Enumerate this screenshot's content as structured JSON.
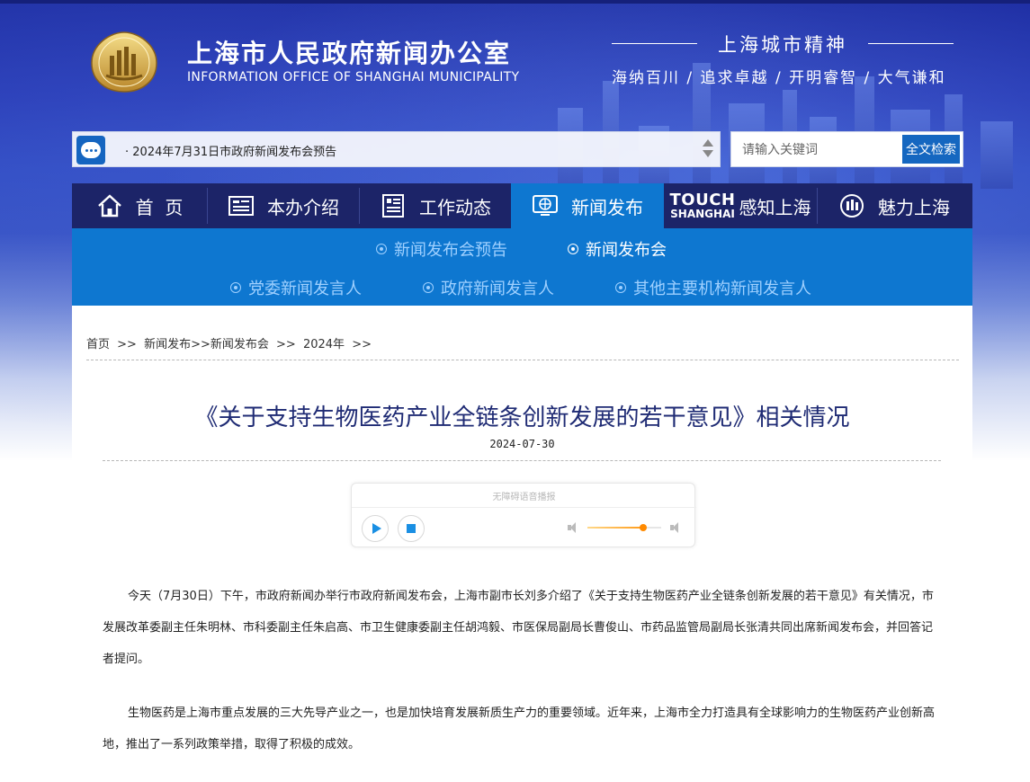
{
  "header": {
    "title": "上海市人民政府新闻办公室",
    "subtitle": "INFORMATION OFFICE OF SHANGHAI MUNICIPALITY",
    "spirit_title": "上海城市精神",
    "spirit_values": "海纳百川 / 追求卓越 / 开明睿智 / 大气谦和"
  },
  "notice": {
    "bullet": "·",
    "text": "2024年7月31日市政府新闻发布会预告"
  },
  "search": {
    "placeholder": "请输入关键词",
    "button_label": "全文检索"
  },
  "nav": {
    "items": [
      {
        "label": "首  页",
        "icon": "home-icon"
      },
      {
        "label": "本办介绍",
        "icon": "info-board-icon"
      },
      {
        "label": "工作动态",
        "icon": "news-doc-icon"
      },
      {
        "label": "新闻发布",
        "icon": "globe-screen-icon",
        "active": true
      },
      {
        "label": "感知上海",
        "badge_line1": "TOUCH",
        "badge_line2": "SHANGHAI"
      },
      {
        "label": "魅力上海",
        "icon": "emblem-icon"
      }
    ]
  },
  "subnav": {
    "items": [
      {
        "label": "新闻发布会预告",
        "active": false
      },
      {
        "label": "新闻发布会",
        "active": true
      },
      {
        "label": "党委新闻发言人",
        "active": false
      },
      {
        "label": "政府新闻发言人",
        "active": false
      },
      {
        "label": "其他主要机构新闻发言人",
        "active": false
      }
    ]
  },
  "breadcrumb": {
    "home": "首页",
    "sep1": ">>",
    "level1": "新闻发布>>新闻发布会",
    "sep2": ">>",
    "level2": "2024年",
    "sep3": ">>"
  },
  "article": {
    "title": "《关于支持生物医药产业全链条创新发展的若干意见》相关情况",
    "date": "2024-07-30",
    "player_label": "无障碍语音播报",
    "volume_level": 0.75,
    "paragraphs": [
      "今天（7月30日）下午，市政府新闻办举行市政府新闻发布会，上海市副市长刘多介绍了《关于支持生物医药产业全链条创新发展的若干意见》有关情况，市发展改革委副主任朱明林、市科委副主任朱启高、市卫生健康委副主任胡鸿毅、市医保局副局长曹俊山、市药品监管局副局长张清共同出席新闻发布会，并回答记者提问。",
      "生物医药是上海市重点发展的三大先导产业之一，也是加快培育发展新质生产力的重要领域。近年来，上海市全力打造具有全球影响力的生物医药产业创新高地，推出了一系列政策举措，取得了积极的成效。"
    ]
  },
  "colors": {
    "nav_bg": "#1c2468",
    "nav_active": "#0e77d0",
    "title_color": "#1f2b74",
    "accent": "#1567c0"
  }
}
